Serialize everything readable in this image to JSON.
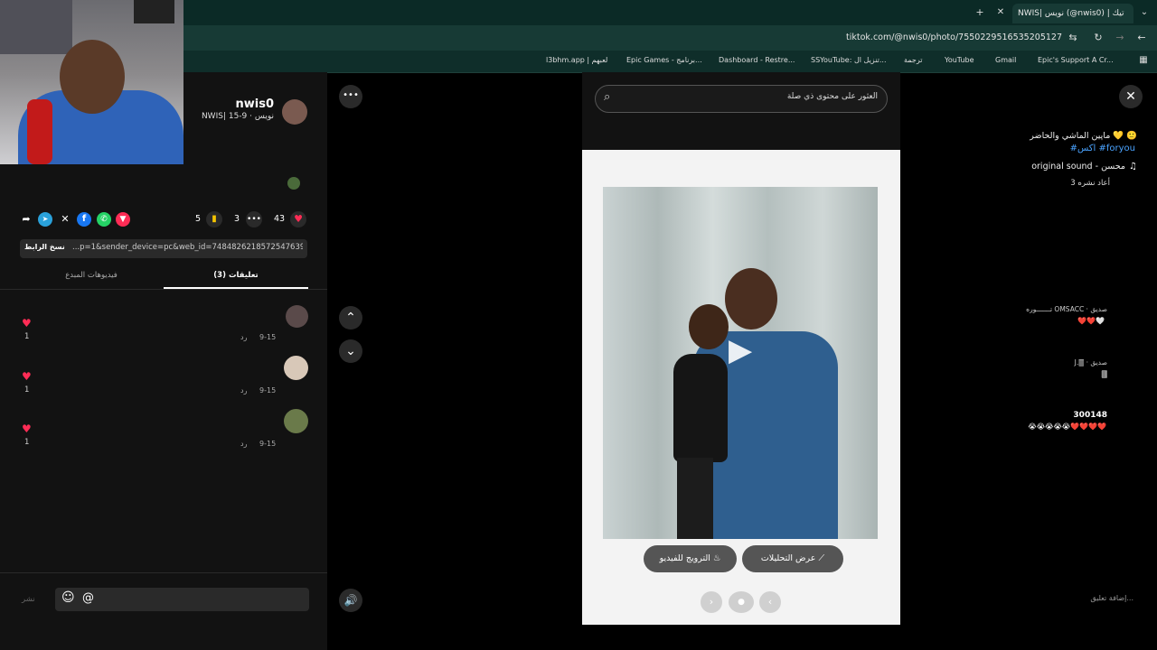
{
  "browser": {
    "tab_title": "NWIS| نويس (@nwis0) | تيك",
    "url": "tiktok.com/@nwis0/photo/7550229516535205127",
    "new_tab": "+",
    "bookmarks": [
      "l3bhm.app | لعبهم",
      "Epic Games - برنامج...",
      "Dashboard - Restre...",
      "SSYouTube: تنزيل ال...",
      "ترجمة",
      "YouTube",
      "Gmail",
      "Epic's Support A Cr..."
    ]
  },
  "post": {
    "username": "nwis0",
    "meta": "NWIS| نويس · 9-15",
    "caption": "ماپين الماشي والحاضر 💛 🙂",
    "hashtags": "#اكس #foryou",
    "sound": "original sound - محسن",
    "reposts": "3 أعاد نشره",
    "like_count": "43",
    "comment_count": "3",
    "save_count": "5",
    "link_text": "...p=1&sender_device=pc&web_id=7484826218572547639",
    "copy_link": "نسخ الرابط"
  },
  "tabs": {
    "comments": "تعليقات (3)",
    "creator_videos": "فيديوهات المبدع"
  },
  "comments": [
    {
      "user": "تـــــــوره OMSACC · صديق",
      "text": "❤️❤️🤍",
      "date": "9-15",
      "reply": "رد",
      "likes": "1"
    },
    {
      "user": "J.🀫 · صديق",
      "text": "🀫",
      "date": "9-15",
      "reply": "رد",
      "likes": "1"
    },
    {
      "user": "300148",
      "text": "😭😭😭😭😭❤️❤️❤️❤️",
      "date": "9-15",
      "reply": "رد",
      "likes": "1"
    }
  ],
  "composer": {
    "placeholder": "إضافة تعليق...",
    "post": "نشر"
  },
  "viewer": {
    "search_placeholder": "العثور على محتوى ذي صلة",
    "promote": "الترويج للفيديو",
    "analytics": "عرض التحليلات",
    "more": "•••"
  }
}
